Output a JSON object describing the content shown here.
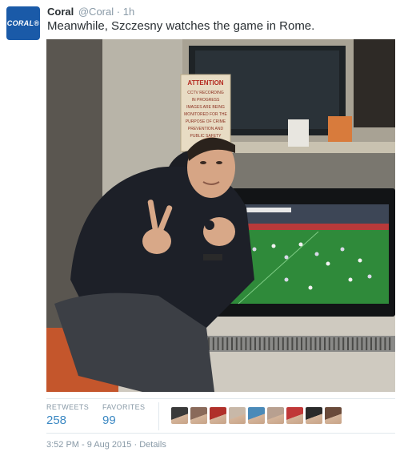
{
  "account": {
    "avatar_text": "CORAL®",
    "name": "Coral",
    "handle": "@Coral",
    "separator": "·",
    "time": "1h"
  },
  "tweet": {
    "text": "Meanwhile, Szczesny watches the game in Rome."
  },
  "photo": {
    "sign_title": "ATTENTION",
    "sign_lines": [
      "CCTV RECORDING",
      "IN PROGRESS",
      "IMAGES ARE BEING",
      "MONITORED FOR THE",
      "PURPOSE OF CRIME",
      "PREVENTION AND",
      "PUBLIC SAFETY"
    ]
  },
  "stats": {
    "retweets_label": "RETWEETS",
    "retweets_count": "258",
    "favorites_label": "FAVORITES",
    "favorites_count": "99"
  },
  "favoriters": [
    {
      "icon": "user-avatar-1",
      "color": "#3a3a3a"
    },
    {
      "icon": "user-avatar-2",
      "color": "#8a6a5a"
    },
    {
      "icon": "user-avatar-3",
      "color": "#b0302a"
    },
    {
      "icon": "user-avatar-4",
      "color": "#c8b8a8"
    },
    {
      "icon": "user-avatar-5",
      "color": "#4a8ab8"
    },
    {
      "icon": "user-avatar-6",
      "color": "#b8a090"
    },
    {
      "icon": "user-avatar-7",
      "color": "#c03838"
    },
    {
      "icon": "user-avatar-8",
      "color": "#2a2a2a"
    },
    {
      "icon": "user-avatar-9",
      "color": "#6a4a3a"
    }
  ],
  "footer": {
    "timestamp": "3:52 PM - 9 Aug 2015",
    "separator": "·",
    "details_link": "Details"
  },
  "colors": {
    "brand_blue": "#1a5aa8",
    "link_blue": "#3b88c3",
    "muted_gray": "#8899a6",
    "pitch_green": "#2f8a3a"
  }
}
